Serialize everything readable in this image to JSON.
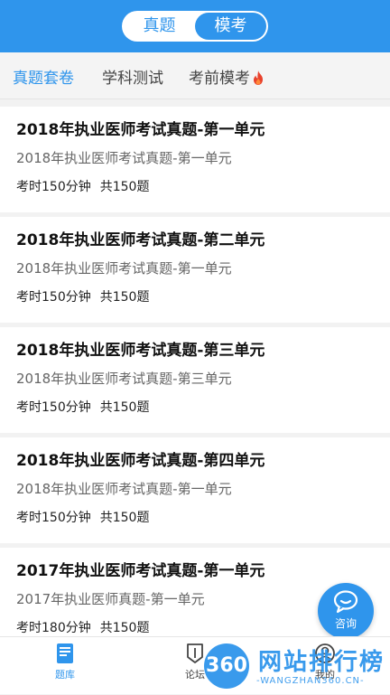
{
  "header": {
    "segment_left": "真题",
    "segment_right": "模考",
    "active_segment": "模考",
    "accent_color": "#2f95ec"
  },
  "subtabs": {
    "items": [
      "真题套卷",
      "学科测试",
      "考前模考"
    ],
    "active": "真题套卷",
    "hot_icon": "flame-icon"
  },
  "exams": [
    {
      "title": "2018年执业医师考试真题-第一单元",
      "subtitle": "2018年执业医师考试真题-第一单元",
      "duration": "考时150分钟",
      "count": "共150题"
    },
    {
      "title": "2018年执业医师考试真题-第二单元",
      "subtitle": "2018年执业医师考试真题-第一单元",
      "duration": "考时150分钟",
      "count": "共150题"
    },
    {
      "title": "2018年执业医师考试真题-第三单元",
      "subtitle": "2018年执业医师考试真题-第三单元",
      "duration": "考时150分钟",
      "count": "共150题"
    },
    {
      "title": "2018年执业医师考试真题-第四单元",
      "subtitle": "2018年执业医师考试真题-第一单元",
      "duration": "考时150分钟",
      "count": "共150题"
    },
    {
      "title": "2017年执业医师考试真题-第一单元",
      "subtitle": "2017年执业医师真题-第一单元",
      "duration": "考时180分钟",
      "count": "共150题"
    }
  ],
  "consult": {
    "label": "咨询",
    "icon": "chat-bubble-icon"
  },
  "bottom_nav": {
    "items": [
      {
        "label": "题库",
        "icon": "book-icon"
      },
      {
        "label": "论坛",
        "icon": "forum-icon"
      },
      {
        "label": "我的",
        "icon": "user-icon"
      }
    ]
  },
  "watermark": {
    "logo": "360",
    "name": "网站排行榜",
    "url": "-WANGZHAN360.CN-"
  }
}
